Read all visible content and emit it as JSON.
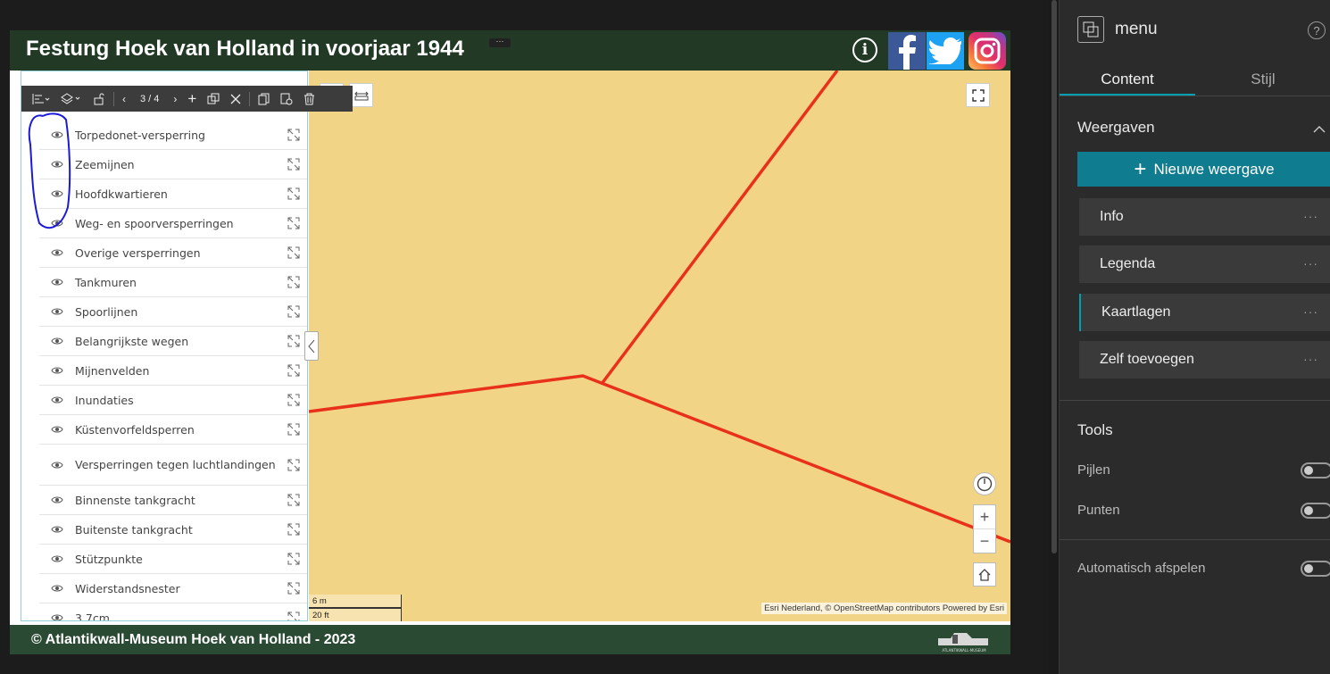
{
  "app": {
    "title": "Festung Hoek van Holland in voorjaar 1944",
    "info_glyph": "i",
    "footer_text": "© Atlantikwall-Museum Hoek van Holland - 2023",
    "footer_logo_caption": "ATLANTIKWALL-MUSEUM"
  },
  "toolbar": {
    "page_indicator": "3 / 4"
  },
  "layers": [
    {
      "label": "Torpedonet-versperring"
    },
    {
      "label": "Zeemijnen"
    },
    {
      "label": "Hoofdkwartieren"
    },
    {
      "label": "Weg- en spoorversperringen"
    },
    {
      "label": "Overige versperringen"
    },
    {
      "label": "Tankmuren"
    },
    {
      "label": "Spoorlijnen"
    },
    {
      "label": "Belangrijkste wegen"
    },
    {
      "label": "Mijnenvelden"
    },
    {
      "label": "Inundaties"
    },
    {
      "label": "Küstenvorfeldsperren"
    },
    {
      "label": "Versperringen tegen luchtlandingen"
    },
    {
      "label": "Binnenste tankgracht"
    },
    {
      "label": "Buitenste tankgracht"
    },
    {
      "label": "Stützpunkte"
    },
    {
      "label": "Widerstandsnester"
    },
    {
      "label": "3,7cm"
    }
  ],
  "map": {
    "attribution": "Esri Nederland, © OpenStreetMap contributors   Powered by Esri",
    "scale_metric": "6 m",
    "scale_imperial": "20 ft",
    "background_color": "#f1d486",
    "line_color": "#e8301a"
  },
  "settings": {
    "title": "menu",
    "help": "?",
    "tabs": [
      {
        "label": "Content"
      },
      {
        "label": "Stijl"
      }
    ],
    "views_heading": "Weergaven",
    "new_view_label": "Nieuwe weergave",
    "views": [
      {
        "label": "Info"
      },
      {
        "label": "Legenda"
      },
      {
        "label": "Kaartlagen"
      },
      {
        "label": "Zelf toevoegen"
      }
    ],
    "tools_heading": "Tools",
    "tool_toggles": [
      {
        "label": "Pijlen"
      },
      {
        "label": "Punten"
      }
    ],
    "autoplay_label": "Automatisch afspelen",
    "accent_color": "#0f7c8f"
  }
}
